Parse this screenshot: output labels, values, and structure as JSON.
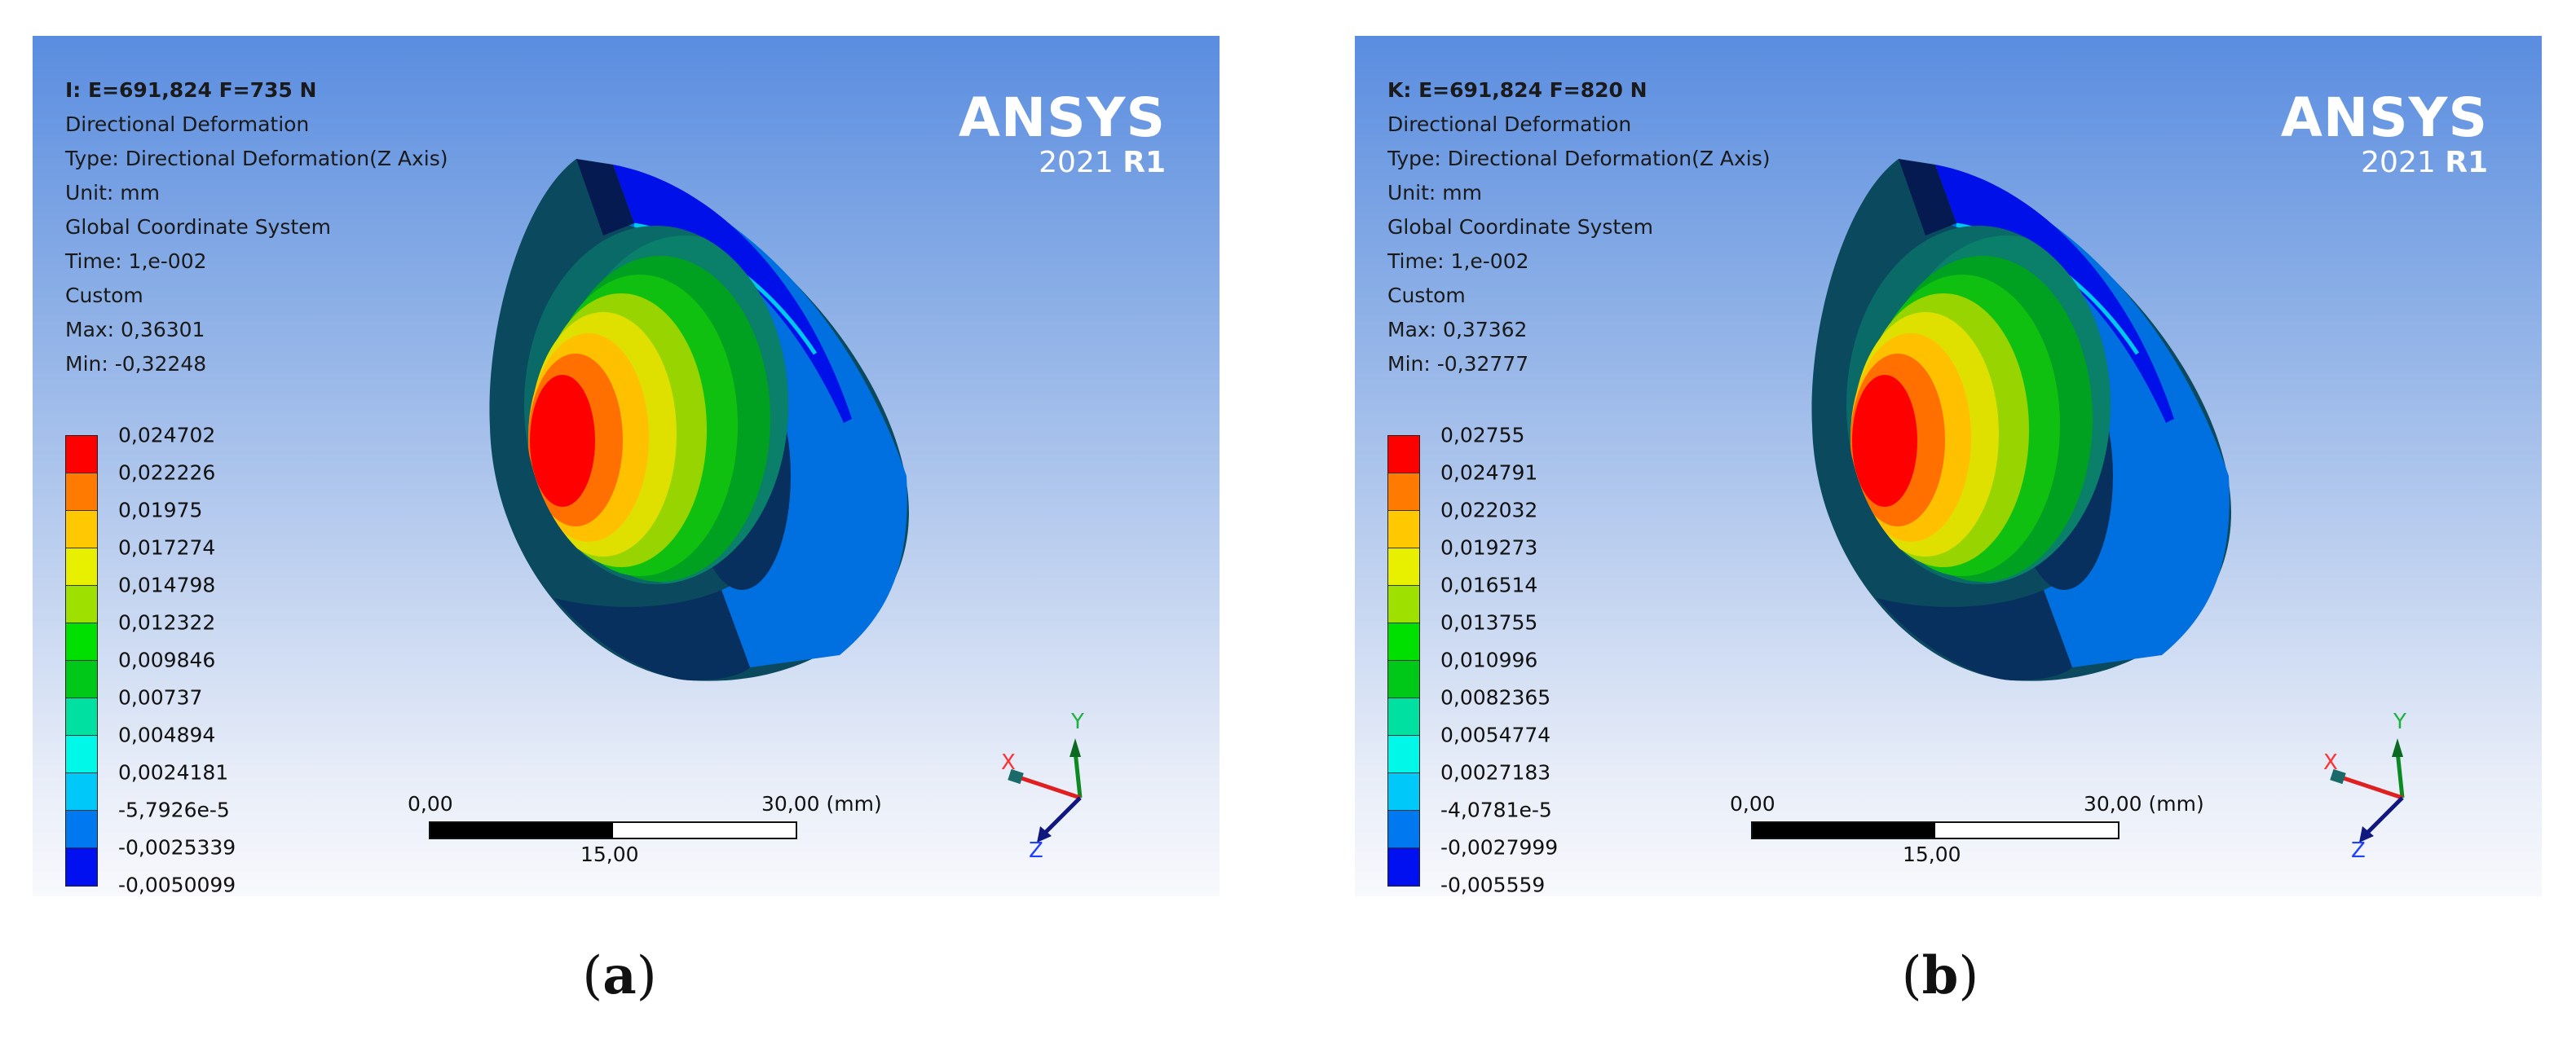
{
  "colors": {
    "legend": [
      "#ff0000",
      "#ff7a00",
      "#ffc800",
      "#e8f000",
      "#9ee000",
      "#00e000",
      "#00c818",
      "#00e0a0",
      "#00f8e8",
      "#00c8f8",
      "#0078f0",
      "#0010f0"
    ],
    "shell_dark": "#0b4a5e",
    "navy": "#07305e",
    "blue_band": "#0010e8",
    "light_blue": "#0070e0"
  },
  "panels": [
    {
      "id": "a",
      "title": "I: E=691,824 F=735 N",
      "lines": [
        "Directional Deformation",
        "Type: Directional Deformation(Z Axis)",
        "Unit: mm",
        "Global Coordinate System",
        "Time: 1,e-002",
        "Custom",
        "Max: 0,36301",
        "Min: -0,32248"
      ],
      "legend_labels": [
        "0,024702",
        "0,022226",
        "0,01975",
        "0,017274",
        "0,014798",
        "0,012322",
        "0,009846",
        "0,00737",
        "0,004894",
        "0,0024181",
        "-5,7926e-5",
        "-0,0025339",
        "-0,0050099"
      ],
      "logo": "ANSYS",
      "version": "2021",
      "release": "R1",
      "scale": {
        "start": "0,00",
        "mid": "15,00",
        "end": "30,00 (mm)"
      },
      "axes": {
        "x": "X",
        "y": "Y",
        "z": "Z"
      },
      "caption": "a"
    },
    {
      "id": "b",
      "title": "K: E=691,824 F=820 N",
      "lines": [
        "Directional Deformation",
        "Type: Directional Deformation(Z Axis)",
        "Unit: mm",
        "Global Coordinate System",
        "Time: 1,e-002",
        "Custom",
        "Max: 0,37362",
        "Min: -0,32777"
      ],
      "legend_labels": [
        "0,02755",
        "0,024791",
        "0,022032",
        "0,019273",
        "0,016514",
        "0,013755",
        "0,010996",
        "0,0082365",
        "0,0054774",
        "0,0027183",
        "-4,0781e-5",
        "-0,0027999",
        "-0,005559"
      ],
      "logo": "ANSYS",
      "version": "2021",
      "release": "R1",
      "scale": {
        "start": "0,00",
        "mid": "15,00",
        "end": "30,00 (mm)"
      },
      "axes": {
        "x": "X",
        "y": "Y",
        "z": "Z"
      },
      "caption": "b"
    }
  ]
}
